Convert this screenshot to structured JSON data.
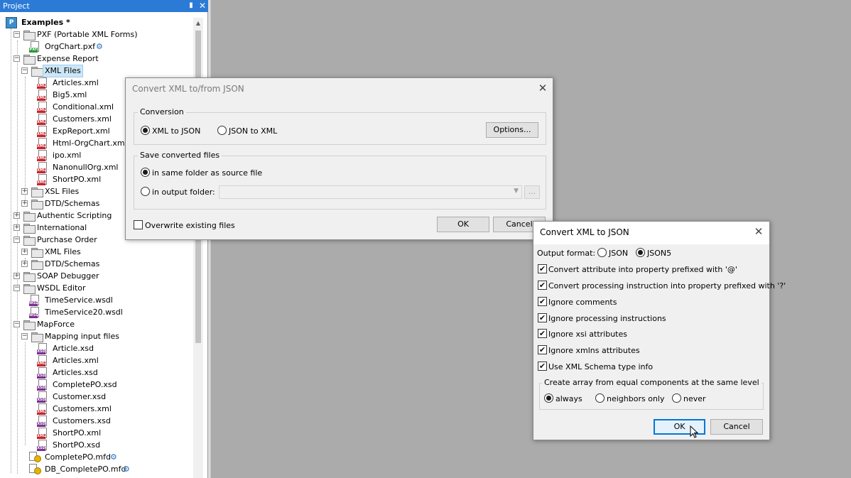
{
  "panel": {
    "title": "Project",
    "pin_glyph": "⬍",
    "close_glyph": "✕"
  },
  "tree": {
    "root": "Examples *",
    "items": [
      {
        "label": "PXF (Portable XML Forms)"
      },
      {
        "label": "OrgChart.pxf"
      },
      {
        "label": "Expense Report"
      },
      {
        "label": "XML Files"
      },
      {
        "label": "Articles.xml"
      },
      {
        "label": "Big5.xml"
      },
      {
        "label": "Conditional.xml"
      },
      {
        "label": "Customers.xml"
      },
      {
        "label": "ExpReport.xml"
      },
      {
        "label": "Html-OrgChart.xml"
      },
      {
        "label": "ipo.xml"
      },
      {
        "label": "NanonullOrg.xml"
      },
      {
        "label": "ShortPO.xml"
      },
      {
        "label": "XSL Files"
      },
      {
        "label": "DTD/Schemas"
      },
      {
        "label": "Authentic Scripting"
      },
      {
        "label": "International"
      },
      {
        "label": "Purchase Order"
      },
      {
        "label": "XML Files"
      },
      {
        "label": "DTD/Schemas"
      },
      {
        "label": "SOAP Debugger"
      },
      {
        "label": "WSDL Editor"
      },
      {
        "label": "TimeService.wsdl"
      },
      {
        "label": "TimeService20.wsdl"
      },
      {
        "label": "MapForce"
      },
      {
        "label": "Mapping input files"
      },
      {
        "label": "Article.xsd"
      },
      {
        "label": "Articles.xml"
      },
      {
        "label": "Articles.xsd"
      },
      {
        "label": "CompletePO.xsd"
      },
      {
        "label": "Customer.xsd"
      },
      {
        "label": "Customers.xml"
      },
      {
        "label": "Customers.xsd"
      },
      {
        "label": "ShortPO.xml"
      },
      {
        "label": "ShortPO.xsd"
      },
      {
        "label": "CompletePO.mfd"
      },
      {
        "label": "DB_CompletePO.mfd"
      }
    ]
  },
  "dialog1": {
    "title": "Convert XML to/from JSON",
    "conversion_group": "Conversion",
    "radio_xml_to_json": "XML to JSON",
    "radio_json_to_xml": "JSON to XML",
    "options_button": "Options...",
    "save_group": "Save converted files",
    "radio_same_folder": "in same folder as source file",
    "radio_output_folder": "in output folder:",
    "browse_button": "...",
    "overwrite_label": "Overwrite existing files",
    "ok_button": "OK",
    "cancel_button": "Cancel",
    "close_glyph": "✕"
  },
  "dialog2": {
    "title": "Convert XML to JSON",
    "output_format_label": "Output format:",
    "format_json": "JSON",
    "format_json5": "JSON5",
    "selected_format": "JSON5",
    "check_attr": "Convert attribute into property prefixed with '@'",
    "check_pi": "Convert processing instruction into property prefixed with '?'",
    "check_comments": "Ignore comments",
    "check_ignore_pi": "Ignore processing instructions",
    "check_xsi": "Ignore xsi attributes",
    "check_xmlns": "Ignore xmlns attributes",
    "check_schema": "Use XML Schema type info",
    "array_group": "Create array from equal components at the same level",
    "array_always": "always",
    "array_neighbors": "neighbors only",
    "array_never": "never",
    "ok_button": "OK",
    "cancel_button": "Cancel",
    "close_glyph": "✕",
    "check_glyph": "✔"
  },
  "colors": {
    "accent": "#2b7bd6",
    "default_button_border": "#0078d7",
    "background": "#ababab"
  }
}
